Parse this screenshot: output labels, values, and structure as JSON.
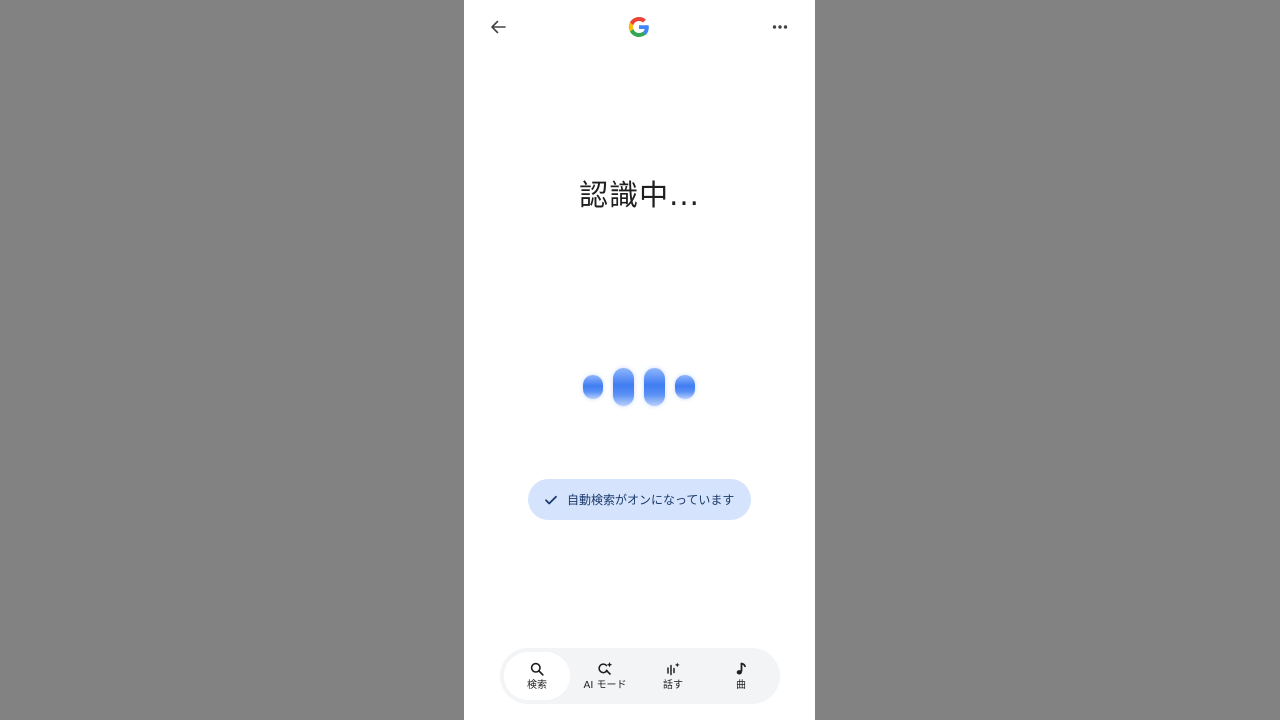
{
  "header": {
    "back_icon": "arrow-left-icon",
    "logo": "google-g-logo",
    "more_icon": "more-horiz-icon"
  },
  "main": {
    "status_text": "認識中..."
  },
  "chip": {
    "icon": "check-icon",
    "label": "自動検索がオンになっています"
  },
  "bottom_nav": {
    "items": [
      {
        "label": "検索",
        "icon": "search-icon",
        "active": true
      },
      {
        "label": "AI モード",
        "icon": "ai-search-icon",
        "active": false
      },
      {
        "label": "話す",
        "icon": "voice-sparkle-icon",
        "active": false
      },
      {
        "label": "曲",
        "icon": "music-note-icon",
        "active": false
      }
    ]
  },
  "colors": {
    "background": "#828282",
    "page": "#ffffff",
    "chip_bg": "#d5e3fc",
    "chip_text": "#1a3a6b",
    "accent_blue": "#3f7df2"
  }
}
